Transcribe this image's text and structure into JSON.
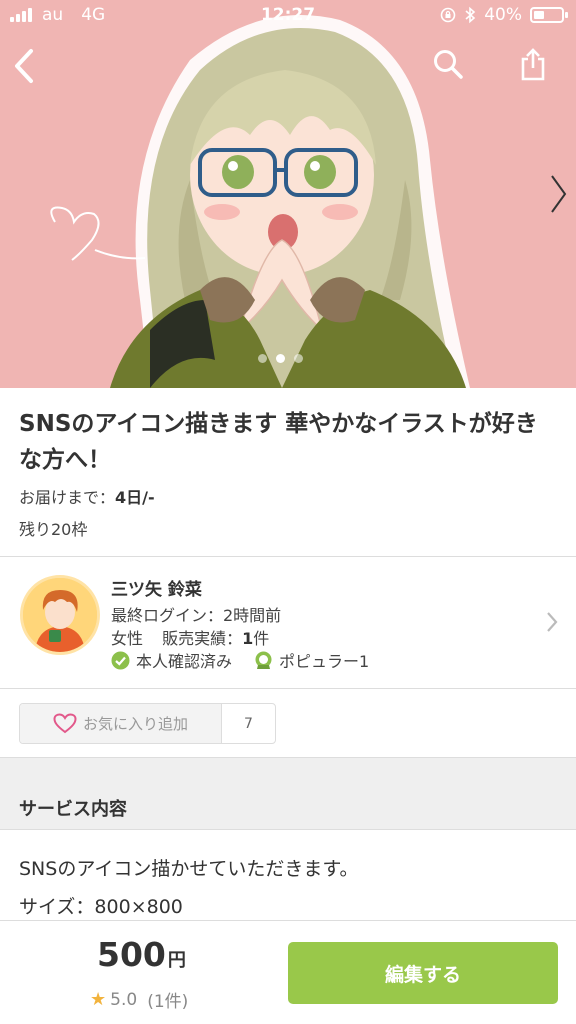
{
  "status": {
    "carrier": "au",
    "network": "4G",
    "time": "12:27",
    "battery": "40%",
    "battery_level": 0.4
  },
  "hero": {
    "slide_count": 3,
    "active_slide": 1
  },
  "product": {
    "title": "SNSのアイコン描きます 華やかなイラストが好きな方へ！",
    "delivery_label": "お届けまで：",
    "delivery_value": "4日/-",
    "remaining": "残り20枠"
  },
  "seller": {
    "name": "三ツ矢 鈴菜",
    "last_login": "最終ログイン：2時間前",
    "gender": "女性",
    "sales_label": "販売実績：",
    "sales_value": "1",
    "sales_unit": "件",
    "badge_verified": "本人確認済み",
    "badge_popular": "ポピュラー1"
  },
  "favorite": {
    "label": "お気に入り追加",
    "count": "7"
  },
  "service": {
    "section_title": "サービス内容",
    "line1": "SNSのアイコン描かせていただきます。",
    "line2": "サイズ：800×800"
  },
  "footer": {
    "price": "500",
    "price_unit": "円",
    "rating": "5.0",
    "rating_count": "(1件)",
    "action_label": "編集する"
  },
  "colors": {
    "hero_bg": "#f0b5b3",
    "accent_green": "#99c84a",
    "star": "#f2b33d",
    "heart": "#e2588a"
  }
}
